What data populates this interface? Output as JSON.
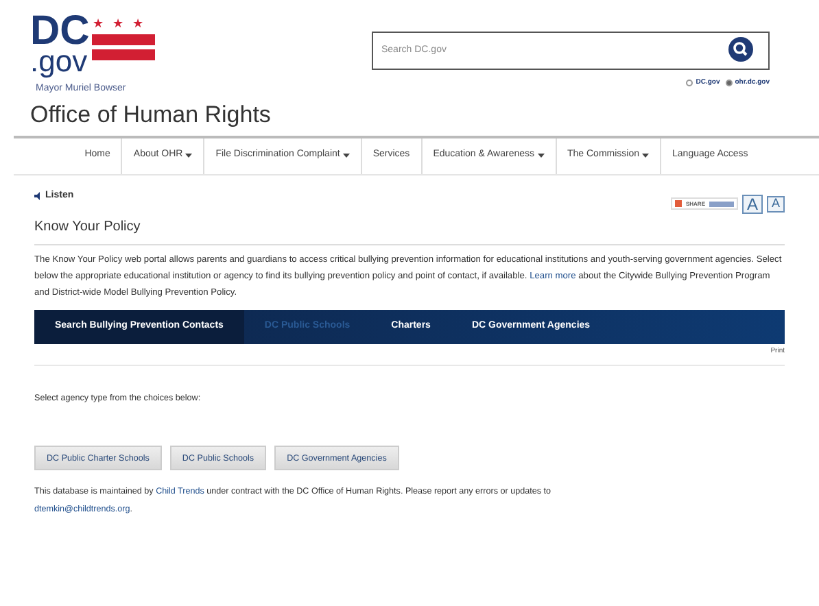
{
  "header": {
    "logo_text": "DC",
    "logo_sub": ".gov",
    "logo_stars": "★ ★ ★",
    "mayor": "Mayor Muriel Bowser",
    "search": {
      "placeholder": "Search DC.gov"
    },
    "scope": [
      {
        "label": "DC.gov",
        "selected": false
      },
      {
        "label": "ohr.dc.gov",
        "selected": true
      }
    ]
  },
  "site_title": "Office of Human Rights",
  "nav": [
    {
      "label": "Home",
      "dropdown": false
    },
    {
      "label": "About OHR",
      "dropdown": true
    },
    {
      "label": "File Discrimination Complaint",
      "dropdown": true
    },
    {
      "label": "Services",
      "dropdown": false
    },
    {
      "label": "Education & Awareness",
      "dropdown": true
    },
    {
      "label": "The Commission",
      "dropdown": true
    },
    {
      "label": "Language Access",
      "dropdown": false
    }
  ],
  "listen": "Listen",
  "share": {
    "label": "SHARE"
  },
  "font_buttons": [
    "A",
    "A"
  ],
  "page_title": "Know Your Policy",
  "intro": {
    "text": "The Know Your Policy web portal allows parents and guardians to access critical bullying prevention information for educational institutions and youth-serving government agencies. Select below the appropriate educational institution or agency to find its bullying prevention policy and point of contact, if available.",
    "link": "Learn more",
    "rest": "about the Citywide Bullying Prevention Program and District-wide Model Bullying Prevention Policy."
  },
  "tabs": [
    {
      "label": "Search Bullying Prevention Contacts",
      "selected": true,
      "dimmed": false
    },
    {
      "label": "DC Public Schools",
      "selected": false,
      "dimmed": true
    },
    {
      "label": "Charters",
      "selected": false,
      "dimmed": false
    },
    {
      "label": "DC Government Agencies",
      "selected": false,
      "dimmed": false
    }
  ],
  "print": "Print",
  "instruction": "Select agency type from the choices below:",
  "choices": [
    "DC Public Charter Schools",
    "DC Public Schools",
    "DC Government Agencies"
  ],
  "footer": {
    "before": "This database is maintained by",
    "link": "Child Trends",
    "after": "under contract with the DC Office of Human Rights. Please report any errors or updates to",
    "email": "dtemkin@childtrends.org",
    "end": "."
  }
}
